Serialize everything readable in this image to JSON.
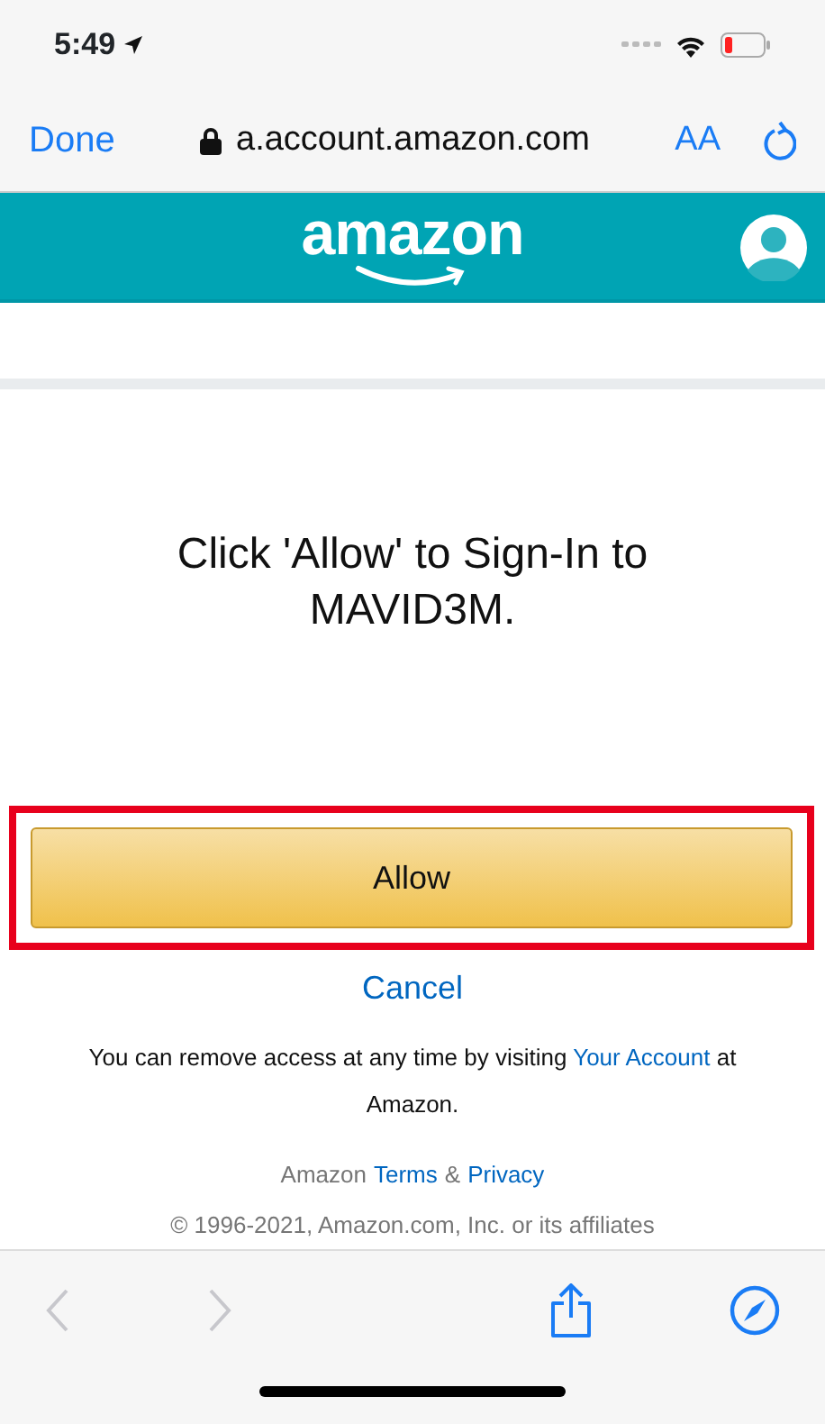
{
  "status_bar": {
    "time": "5:49"
  },
  "browser_bar": {
    "done": "Done",
    "url": "a.account.amazon.com",
    "text_size": "AA"
  },
  "header": {
    "logo": "amazon"
  },
  "prompt": "Click 'Allow' to Sign-In to MAVID3M.",
  "allow_button": {
    "label": "Allow",
    "highlighted": true
  },
  "cancel_link": "Cancel",
  "notice": {
    "before": "You can remove access at any time by visiting",
    "link": "Your Account",
    "after": "at Amazon."
  },
  "footer": {
    "brand": "Amazon",
    "terms": "Terms",
    "amp": "&",
    "privacy": "Privacy",
    "copyright": "© 1996-2021, Amazon.com, Inc. or its affiliates"
  },
  "toolbar": [
    {
      "kind": "back",
      "disabled": true
    },
    {
      "kind": "forward",
      "disabled": true
    },
    {
      "kind": "share",
      "disabled": false
    },
    {
      "kind": "compass",
      "disabled": false
    }
  ]
}
